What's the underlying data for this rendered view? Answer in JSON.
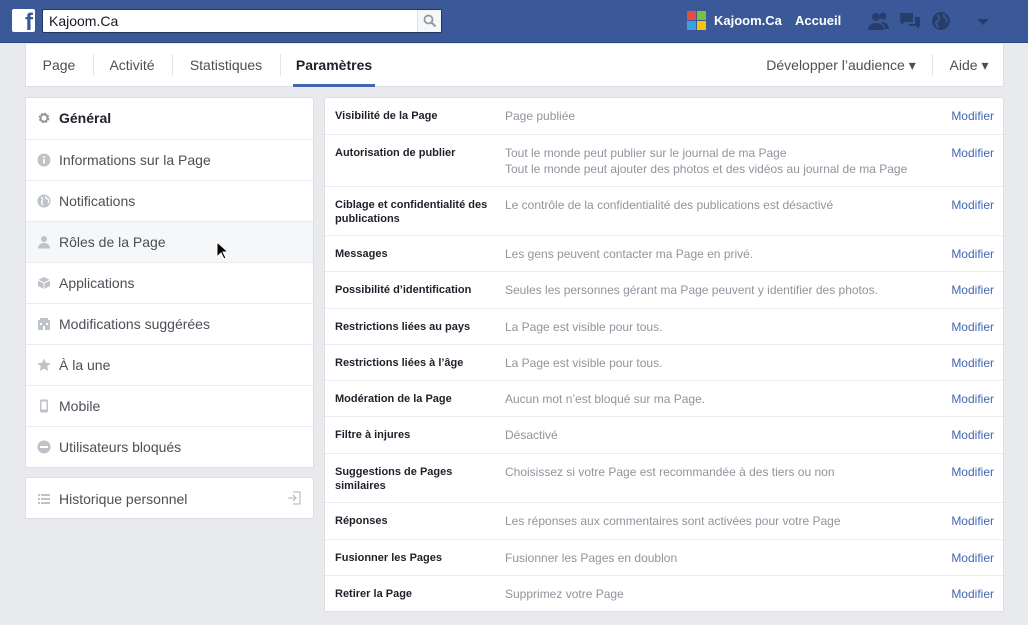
{
  "topbar": {
    "logo_letter": "f",
    "search_value": "Kajoom.Ca",
    "profile_name": "Kajoom.Ca",
    "home_label": "Accueil",
    "colors": {
      "bar": "#3b5998",
      "accent": "#4267b2"
    }
  },
  "tabs": {
    "page": "Page",
    "activity": "Activité",
    "stats": "Statistiques",
    "settings": "Paramètres",
    "audience": "Développer l’audience ▾",
    "help": "Aide ▾"
  },
  "sidebar": {
    "items": [
      {
        "label": "Général",
        "icon": "gear-icon"
      },
      {
        "label": "Informations sur la Page",
        "icon": "info-icon"
      },
      {
        "label": "Notifications",
        "icon": "globe-icon"
      },
      {
        "label": "Rôles de la Page",
        "icon": "person-icon"
      },
      {
        "label": "Applications",
        "icon": "cube-icon"
      },
      {
        "label": "Modifications suggérées",
        "icon": "building-icon"
      },
      {
        "label": "À la une",
        "icon": "star-icon"
      },
      {
        "label": "Mobile",
        "icon": "phone-icon"
      },
      {
        "label": "Utilisateurs bloqués",
        "icon": "blocked-icon"
      }
    ],
    "history": {
      "label": "Historique personnel",
      "icon": "list-icon",
      "action_icon": "export-icon"
    }
  },
  "settings": {
    "edit_label": "Modifier",
    "rows": [
      {
        "label": "Visibilité de la Page",
        "desc": "Page publiée"
      },
      {
        "label": "Autorisation de publier",
        "desc": "Tout le monde peut publier sur le journal de ma Page",
        "desc2": "Tout le monde peut ajouter des photos et des vidéos au journal de ma Page"
      },
      {
        "label": "Ciblage et confidentialité des publications",
        "desc": "Le contrôle de la confidentialité des publications est désactivé"
      },
      {
        "label": "Messages",
        "desc": "Les gens peuvent contacter ma Page en privé."
      },
      {
        "label": "Possibilité d’identification",
        "desc": "Seules les personnes gérant ma Page peuvent y identifier des photos."
      },
      {
        "label": "Restrictions liées au pays",
        "desc": "La Page est visible pour tous."
      },
      {
        "label": "Restrictions liées à l’âge",
        "desc": "La Page est visible pour tous."
      },
      {
        "label": "Modération de la Page",
        "desc": "Aucun mot n’est bloqué sur ma Page."
      },
      {
        "label": "Filtre à injures",
        "desc": "Désactivé"
      },
      {
        "label": "Suggestions de Pages similaires",
        "desc": "Choisissez si votre Page est recommandée à des tiers ou non"
      },
      {
        "label": "Réponses",
        "desc": "Les réponses aux commentaires sont activées pour votre Page"
      },
      {
        "label": "Fusionner les Pages",
        "desc": "Fusionner les Pages en doublon"
      },
      {
        "label": "Retirer la Page",
        "desc": "Supprimez votre Page"
      }
    ]
  }
}
